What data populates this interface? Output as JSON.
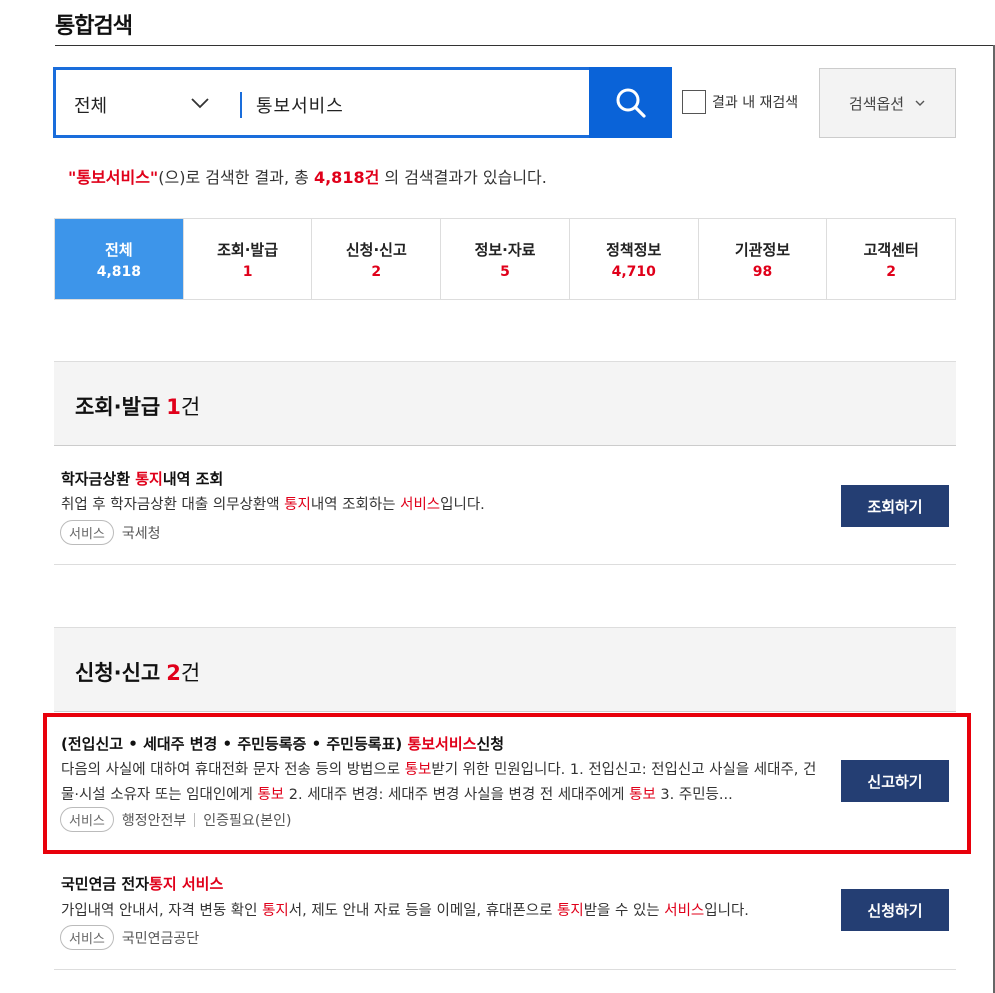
{
  "page_title": "통합검색",
  "search": {
    "scope": "전체",
    "query": "통보서비스",
    "recheck_label": "결과 내 재검색",
    "options_label": "검색옵션"
  },
  "summary": {
    "q": "\"통보서비스\"",
    "t1": "(으)로 검색한 결과, 총 ",
    "total": "4,818건",
    "t2": " 의 검색결과가 있습니다."
  },
  "tabs": [
    {
      "label": "전체",
      "count": "4,818"
    },
    {
      "label": "조회·발급",
      "count": "1"
    },
    {
      "label": "신청·신고",
      "count": "2"
    },
    {
      "label": "정보·자료",
      "count": "5"
    },
    {
      "label": "정책정보",
      "count": "4,710"
    },
    {
      "label": "기관정보",
      "count": "98"
    },
    {
      "label": "고객센터",
      "count": "2"
    }
  ],
  "sections": [
    {
      "title": "조회·발급",
      "count": "1",
      "unit": "건"
    },
    {
      "title": "신청·신고",
      "count": "2",
      "unit": "건"
    }
  ],
  "items": [
    {
      "title": [
        "학자금상환 ",
        "통지",
        "내역 조회"
      ],
      "desc": [
        "취업 후 학자금상환 대출 의무상환액 ",
        "통지",
        "내역 조회하는 ",
        "서비스",
        "입니다."
      ],
      "tag": "서비스",
      "agency": "국세청",
      "button": "조회하기"
    },
    {
      "title": [
        "(전입신고 • 세대주 변경 • 주민등록증 • 주민등록표) ",
        "통보서비스",
        "신청"
      ],
      "desc": [
        "다음의 사실에 대하여 휴대전화 문자 전송 등의 방법으로 ",
        "통보",
        "받기 위한 민원입니다. 1. 전입신고: 전입신고 사실을 세대주, 건물·시설 소유자 또는 임대인에게 ",
        "통보",
        " 2. 세대주 변경: 세대주 변경 사실을 변경 전 세대주에게 ",
        "통보",
        " 3. 주민등..."
      ],
      "tag": "서비스",
      "agency": "행정안전부",
      "extra": "인증필요(본인)",
      "button": "신고하기"
    },
    {
      "title": [
        "국민연금 전자",
        "통지 서비스",
        ""
      ],
      "desc": [
        "가입내역 안내서, 자격 변동 확인 ",
        "통지",
        "서, 제도 안내 자료 등을 이메일, 휴대폰으로 ",
        "통지",
        "받을 수 있는 ",
        "서비스",
        "입니다."
      ],
      "tag": "서비스",
      "agency": "국민연금공단",
      "button": "신청하기"
    }
  ],
  "colors": {
    "accent": "#0a63d8",
    "active_tab": "#3d95ea",
    "highlight": "#e0001a",
    "button": "#243e73"
  }
}
